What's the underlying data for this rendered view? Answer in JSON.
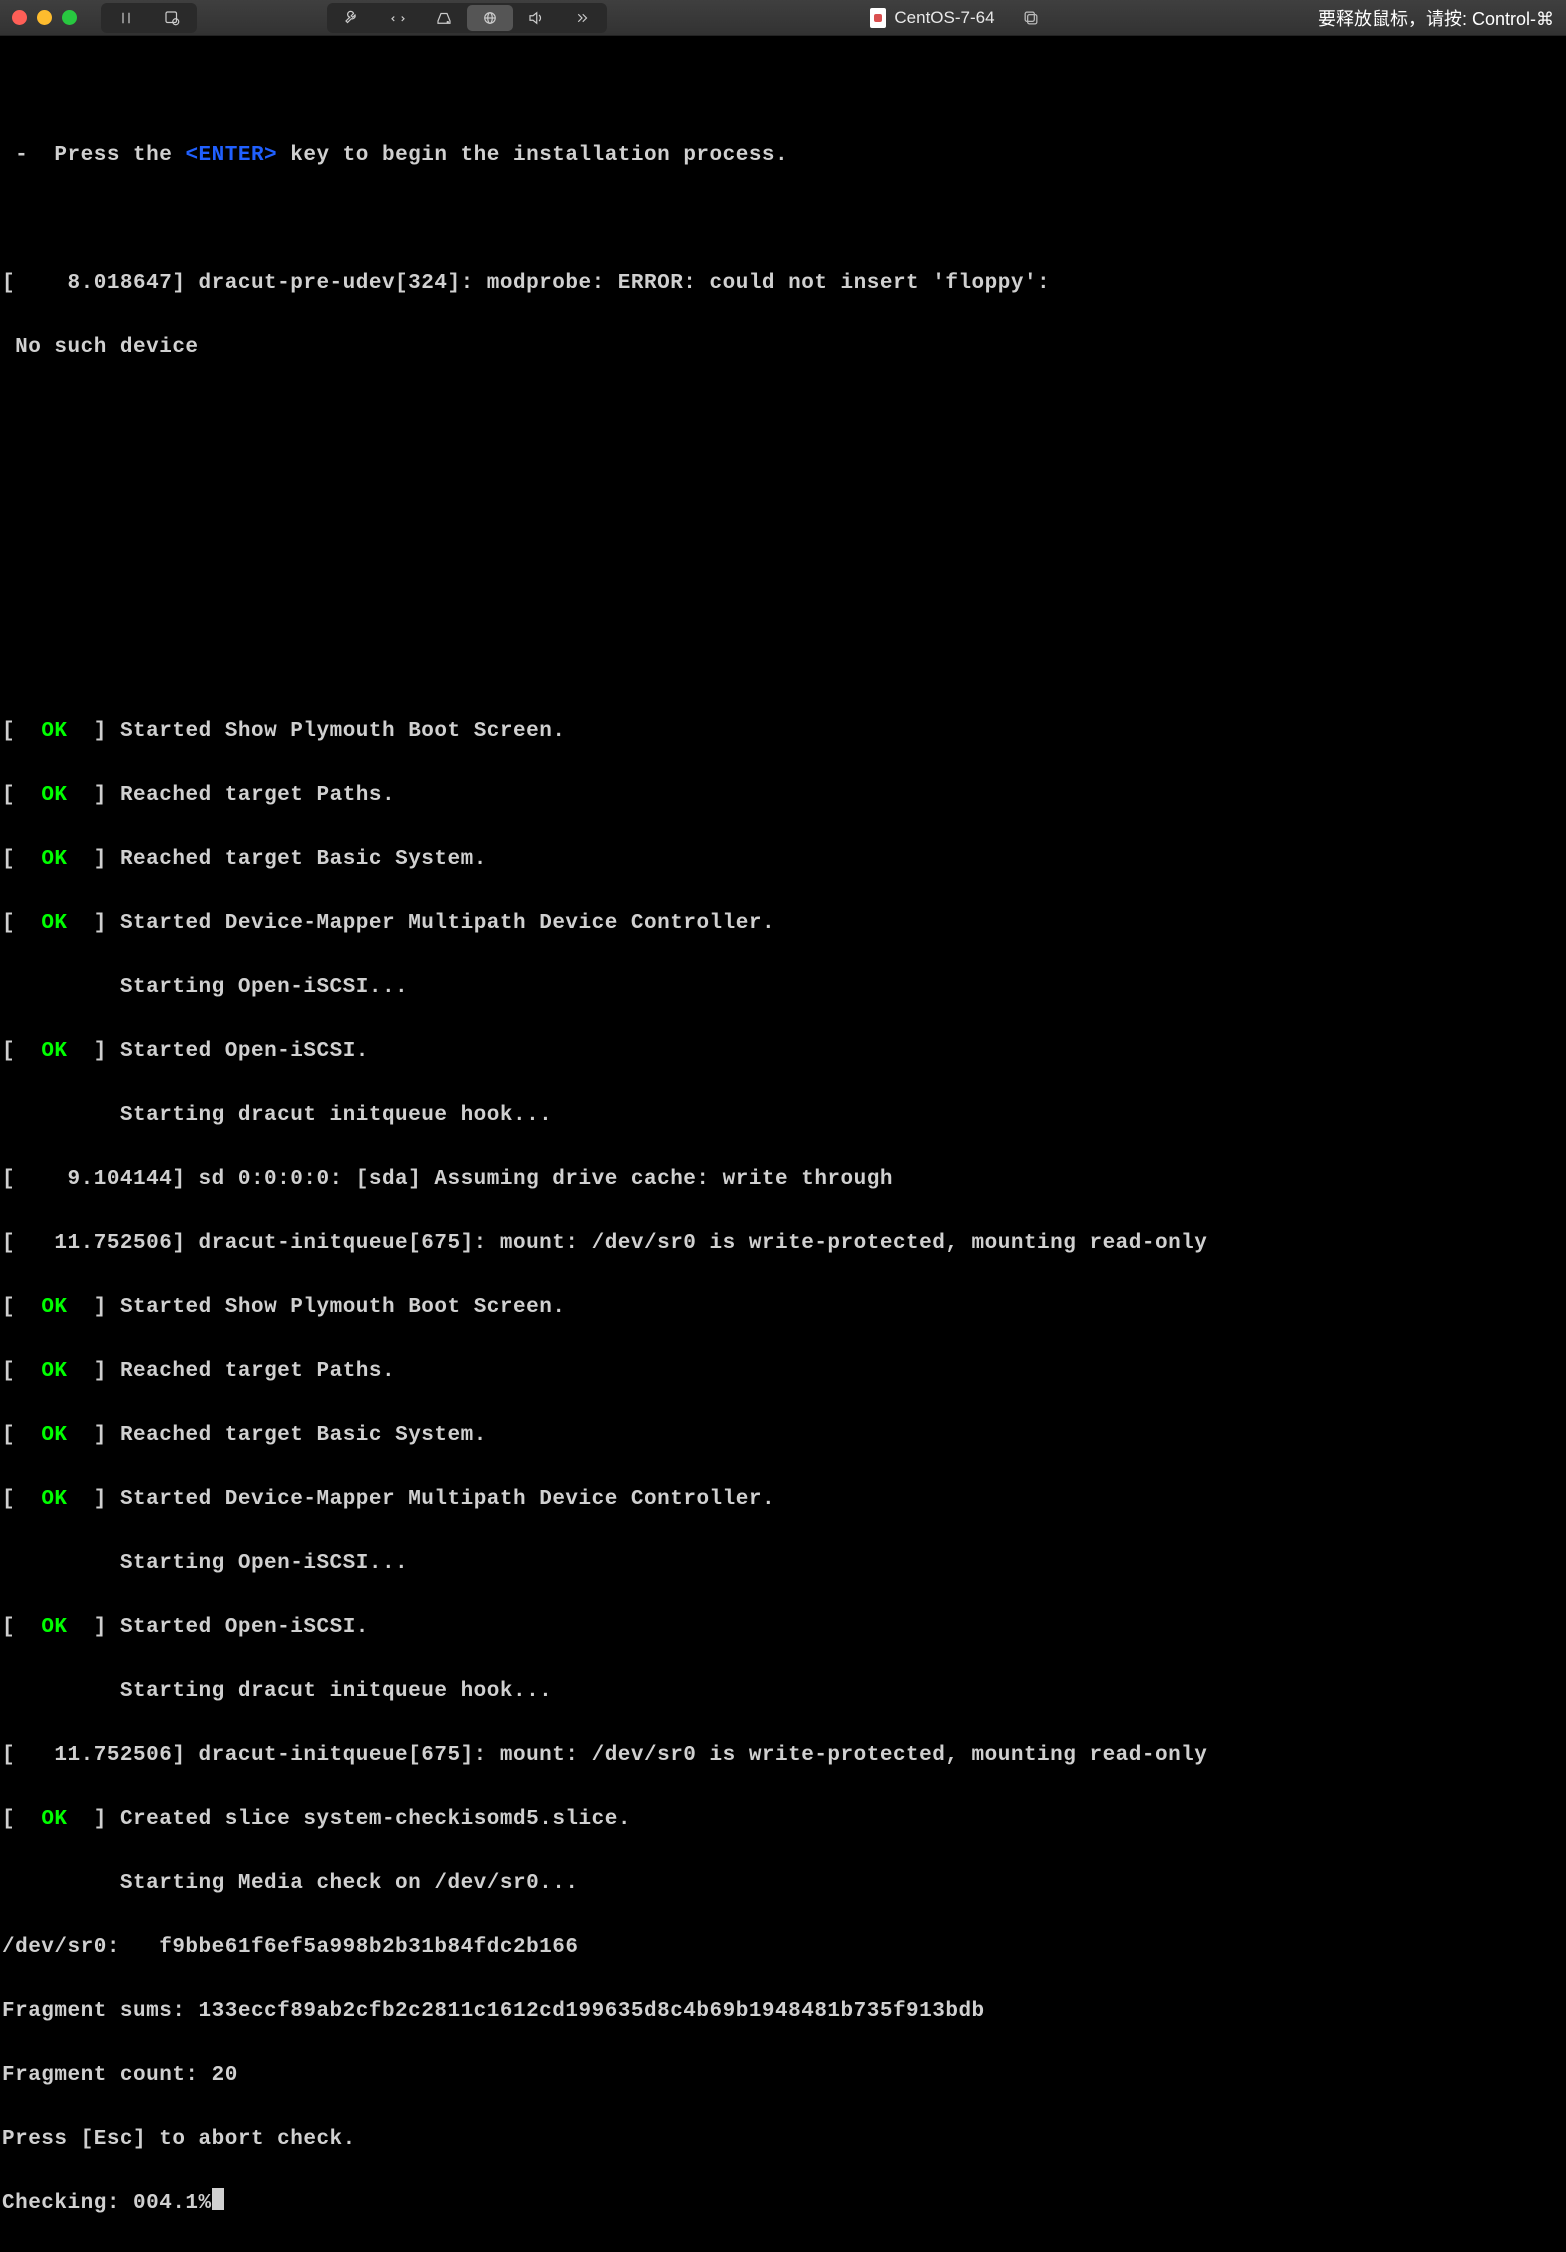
{
  "titlebar": {
    "vm_name": "CentOS-7-64",
    "hint": "要释放鼠标，请按: Control-⌘"
  },
  "toolbar": {
    "icons": {
      "pause": "pause-icon",
      "snapshot": "snapshot-icon",
      "wrench": "wrench-icon",
      "resize": "resize-icon",
      "disk": "disk-icon",
      "network": "network-icon",
      "sound": "sound-icon",
      "more": "more-icon",
      "copy": "copy-icon"
    }
  },
  "console": {
    "prompt_prefix": " -  Press the ",
    "enter": "<ENTER>",
    "prompt_suffix": " key to begin the installation process.",
    "err1_a": "[    8.018647] dracut-pre-udev[324]: modprobe: ERROR: could not insert 'floppy':",
    "err1_b": " No such device",
    "ok_label": "OK",
    "lines_block1": {
      "l1": "] Started Show Plymouth Boot Screen.",
      "l2": "] Reached target Paths.",
      "l3": "] Reached target Basic System.",
      "l4": "] Started Device-Mapper Multipath Device Controller.",
      "l5": "         Starting Open-iSCSI...",
      "l6": "] Started Open-iSCSI.",
      "l7": "         Starting dracut initqueue hook...",
      "l8": "[    9.104144] sd 0:0:0:0: [sda] Assuming drive cache: write through",
      "l9": "[   11.752506] dracut-initqueue[675]: mount: /dev/sr0 is write-protected, mounting read-only"
    },
    "lines_block2": {
      "l1": "] Started Show Plymouth Boot Screen.",
      "l2": "] Reached target Paths.",
      "l3": "] Reached target Basic System.",
      "l4": "] Started Device-Mapper Multipath Device Controller.",
      "l5": "         Starting Open-iSCSI...",
      "l6": "] Started Open-iSCSI.",
      "l7": "         Starting dracut initqueue hook...",
      "l8": "[   11.752506] dracut-initqueue[675]: mount: /dev/sr0 is write-protected, mounting read-only",
      "l9": "] Created slice system-checkisomd5.slice.",
      "l10": "         Starting Media check on /dev/sr0..."
    },
    "md5": {
      "dev": "/dev/sr0:   f9bbe61f6ef5a998b2b31b84fdc2b166",
      "sums": "Fragment sums: 133eccf89ab2cfb2c2811c1612cd199635d8c4b69b1948481b735f913bdb",
      "count": "Fragment count: 20",
      "abort": "Press [Esc] to abort check.",
      "checking": "Checking: 004.1%"
    }
  }
}
